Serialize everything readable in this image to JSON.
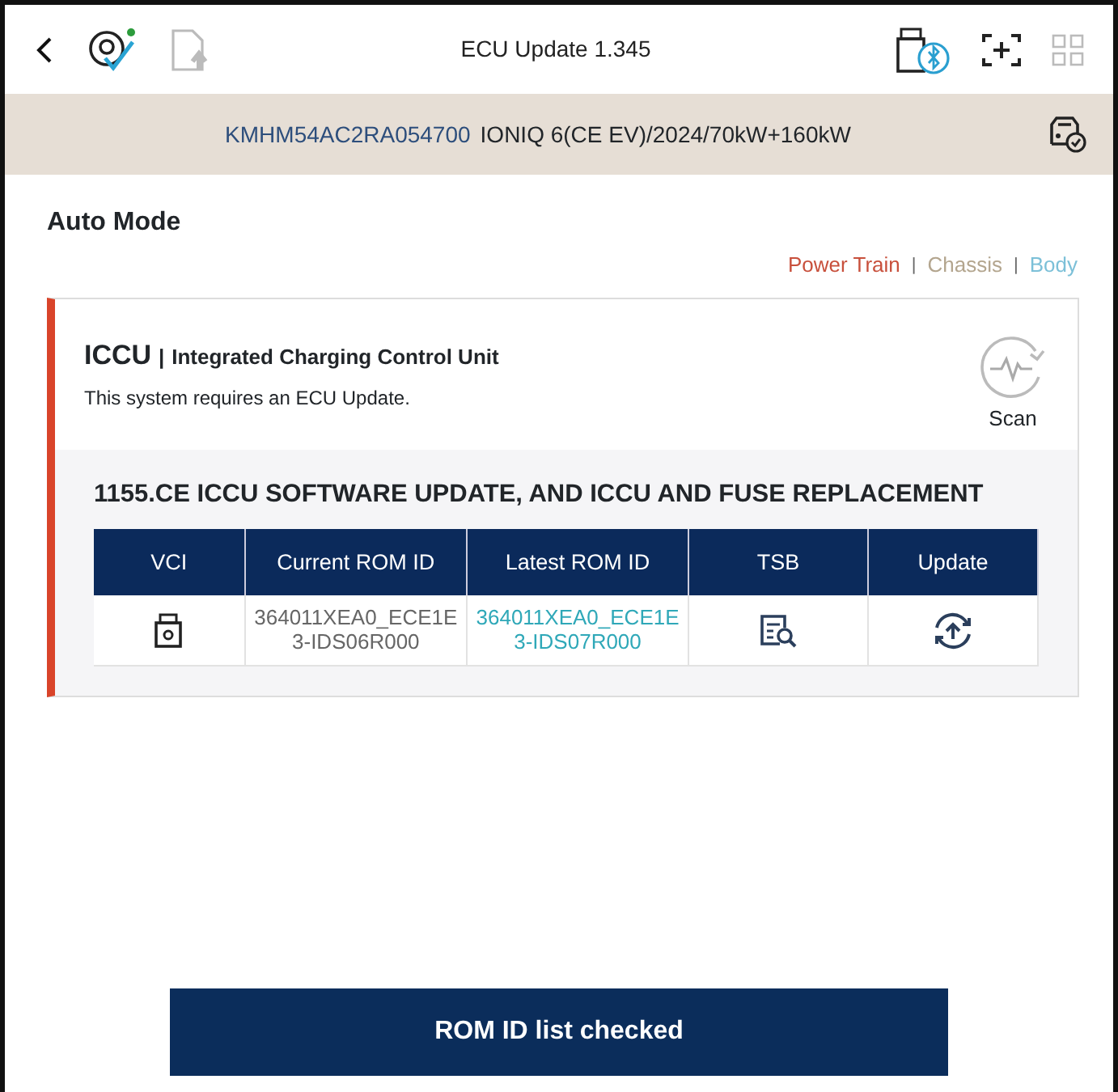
{
  "top_bar": {
    "title": "ECU Update 1.345"
  },
  "vehicle_bar": {
    "vin": "KMHM54AC2RA054700",
    "model": "IONIQ 6(CE EV)/2024/70kW+160kW"
  },
  "mode_title": "Auto Mode",
  "filters": [
    {
      "label": "Power Train",
      "color": "#c8503c"
    },
    {
      "label": "Chassis",
      "color": "#b3a58e"
    },
    {
      "label": "Body",
      "color": "#7cc0d8"
    }
  ],
  "separator": "|",
  "system": {
    "code": "ICCU",
    "name": "Integrated Charging Control Unit",
    "message": "This system requires an ECU Update.",
    "scan_label": "Scan"
  },
  "update": {
    "title": "1155.CE ICCU SOFTWARE UPDATE, AND ICCU AND FUSE REPLACEMENT",
    "columns": [
      "VCI",
      "Current ROM ID",
      "Latest ROM ID",
      "TSB",
      "Update"
    ],
    "rows": [
      {
        "current_rom_id": "364011XEA0_ECE1E3-IDS06R000",
        "latest_rom_id": "364011XEA0_ECE1E3-IDS07R000"
      }
    ]
  },
  "footer_button": "ROM ID list checked"
}
